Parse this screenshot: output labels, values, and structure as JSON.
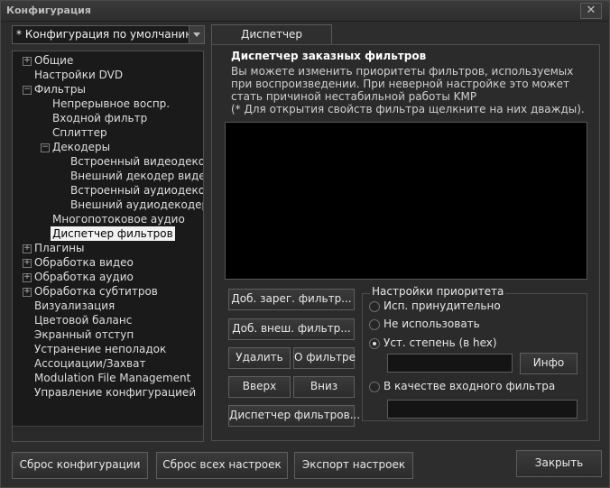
{
  "window": {
    "title": "Конфигурация"
  },
  "config_combo": {
    "value": "* Конфигурация по умолчанию"
  },
  "tree": {
    "items": [
      {
        "label": "Общие",
        "expander": "+"
      },
      {
        "label": "Настройки DVD"
      },
      {
        "label": "Фильтры",
        "expander": "−"
      },
      {
        "label": "Непрерывное воспр."
      },
      {
        "label": "Входной фильтр"
      },
      {
        "label": "Сплиттер"
      },
      {
        "label": "Декодеры",
        "expander": "−"
      },
      {
        "label": "Встроенный видеодекодер"
      },
      {
        "label": "Внешний декодер видео"
      },
      {
        "label": "Встроенный аудиодекодер"
      },
      {
        "label": "Внешний аудиодекодер"
      },
      {
        "label": "Многопотоковое аудио"
      },
      {
        "label": "Диспетчер фильтров",
        "selected": true
      },
      {
        "label": "Плагины",
        "expander": "+"
      },
      {
        "label": "Обработка видео",
        "expander": "+"
      },
      {
        "label": "Обработка аудио",
        "expander": "+"
      },
      {
        "label": "Обработка субтитров",
        "expander": "+"
      },
      {
        "label": "Визуализация"
      },
      {
        "label": "Цветовой баланс"
      },
      {
        "label": "Экранный отступ"
      },
      {
        "label": "Устранение неполадок"
      },
      {
        "label": "Ассоциации/Захват"
      },
      {
        "label": "Modulation File Management"
      },
      {
        "label": "Управление конфигурацией"
      }
    ]
  },
  "tab": {
    "label": "Диспетчер фильтров"
  },
  "panel": {
    "group_title": "Диспетчер заказных фильтров",
    "desc_lines": [
      "Вы можете изменить приоритеты фильтров, используемых",
      "при воспроизведении. При неверной настройке это может",
      "стать причиной нестабильной работы KMP",
      "(* Для открытия свойств фильтра щелкните на них дважды)."
    ],
    "buttons": {
      "add_registered": "Доб. зарег. фильтр...",
      "add_external": "Доб. внеш. фильтр...",
      "delete": "Удалить",
      "about": "О фильтре",
      "up": "Вверх",
      "down": "Вниз",
      "filter_manager": "Диспетчер фильтров..."
    },
    "priority": {
      "title": "Настройки приоритета",
      "options": [
        "Исп. принудительно",
        "Не использовать",
        "Уст. степень (в hex)",
        "В качестве входного фильтра"
      ],
      "selected_index": 2,
      "info_button": "Инфо"
    }
  },
  "footer": {
    "reset_config": "Сброс конфигурации",
    "reset_all": "Сброс всех настроек",
    "export": "Экспорт настроек",
    "close": "Закрыть"
  }
}
